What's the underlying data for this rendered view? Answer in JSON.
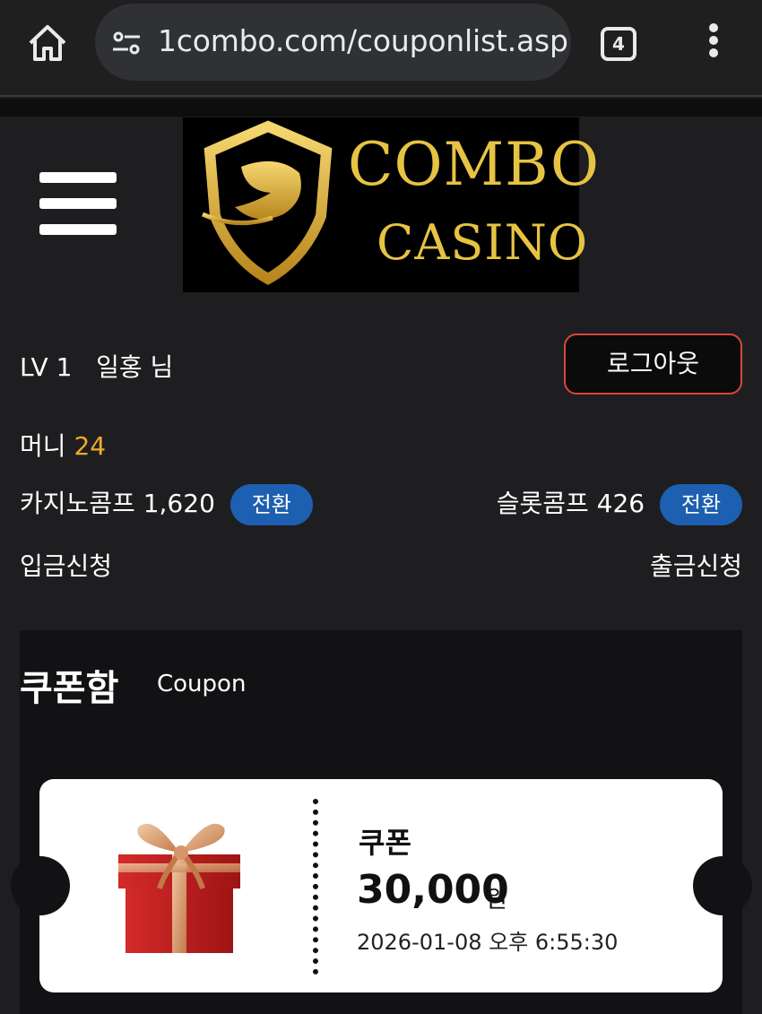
{
  "browser": {
    "url": "1combo.com/couponlist.asp",
    "tab_count": "4"
  },
  "header": {
    "logo_line1": "COMBO",
    "logo_line2": "CASINO"
  },
  "user": {
    "level": "LV 1",
    "name": "일홍 님",
    "logout_label": "로그아웃",
    "money_label": "머니",
    "money_value": "24",
    "casino_comp_label": "카지노콤프",
    "casino_comp_value": "1,620",
    "slot_comp_label": "슬롯콤프",
    "slot_comp_value": "426",
    "convert_label": "전환",
    "deposit_label": "입금신청",
    "withdraw_label": "출금신청"
  },
  "coupon_box": {
    "title": "쿠폰함",
    "subtitle": "Coupon",
    "coupons": [
      {
        "name": "쿠폰",
        "amount": "30,000",
        "unit": "원",
        "date": "2026-01-08 오후 6:55:30"
      }
    ]
  },
  "colors": {
    "accent_gold": "#e6c343",
    "money_orange": "#f1a92c",
    "convert_blue": "#1d5fb0",
    "logout_border": "#d8463e"
  }
}
